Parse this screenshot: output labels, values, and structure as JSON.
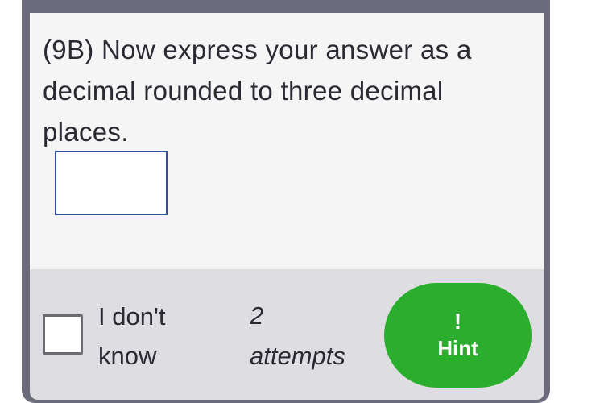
{
  "question": {
    "text": "(9B) Now express your answer as a decimal rounded to three decimal places.",
    "answer_value": ""
  },
  "footer": {
    "dont_know_label": "I don't know",
    "attempts_count": "2",
    "attempts_label": "attempts",
    "hint_icon": "!",
    "hint_label": "Hint"
  },
  "colors": {
    "frame": "#6b6b7b",
    "hint_green": "#2bad2e",
    "input_border": "#2f4fa4"
  },
  "icons": {
    "hint": "exclamation-icon"
  }
}
